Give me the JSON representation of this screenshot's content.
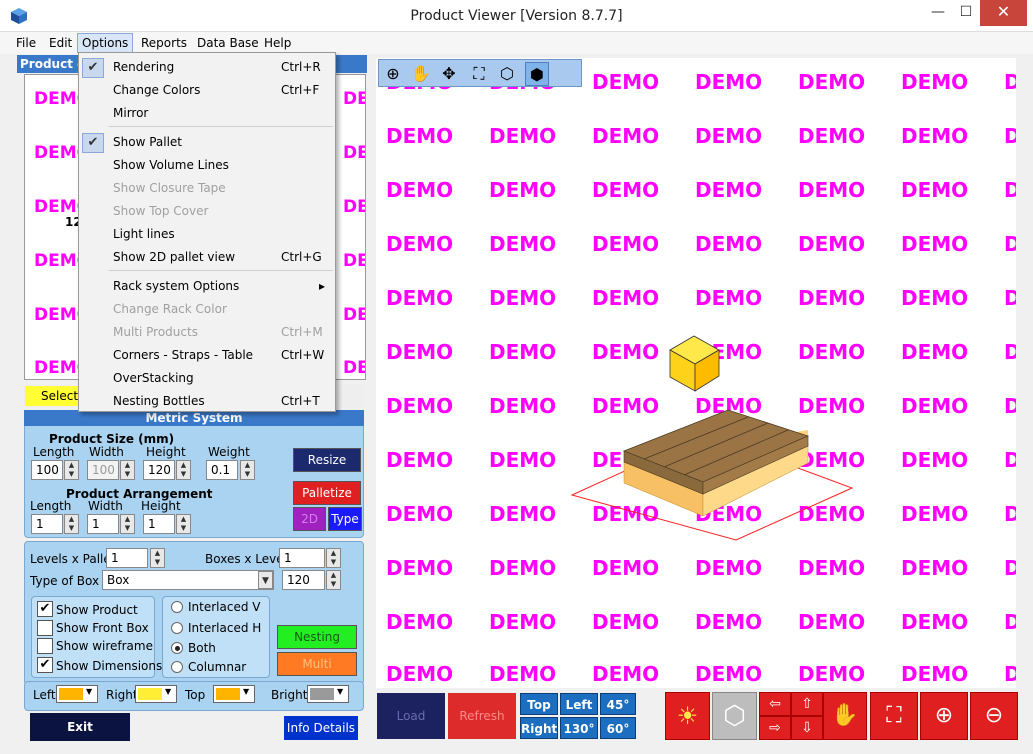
{
  "window": {
    "title": "Product Viewer [Version 8.7.7]",
    "minimize": "—",
    "maximize": "☐",
    "close": "✕"
  },
  "menubar": [
    "File",
    "Edit",
    "Options",
    "Reports",
    "Data Base",
    "Help"
  ],
  "options_menu": [
    {
      "label": "Rendering",
      "shortcut": "Ctrl+R",
      "checked": true,
      "disabled": false
    },
    {
      "label": "Change Colors",
      "shortcut": "Ctrl+F",
      "checked": false,
      "disabled": false
    },
    {
      "label": "Mirror",
      "shortcut": "",
      "checked": false,
      "disabled": false
    },
    {
      "label": "Show Pallet",
      "shortcut": "",
      "checked": true,
      "disabled": false
    },
    {
      "label": "Show Volume Lines",
      "shortcut": "",
      "checked": false,
      "disabled": false
    },
    {
      "label": "Show Closure Tape",
      "shortcut": "",
      "checked": false,
      "disabled": true
    },
    {
      "label": "Show Top Cover",
      "shortcut": "",
      "checked": false,
      "disabled": true
    },
    {
      "label": "Light lines",
      "shortcut": "",
      "checked": false,
      "disabled": false
    },
    {
      "label": "Show 2D pallet view",
      "shortcut": "Ctrl+G",
      "checked": false,
      "disabled": false
    },
    {
      "label": "Rack system Options",
      "shortcut": "▸",
      "checked": false,
      "disabled": false
    },
    {
      "label": "Change Rack Color",
      "shortcut": "",
      "checked": false,
      "disabled": true
    },
    {
      "label": "Multi Products",
      "shortcut": "Ctrl+M",
      "checked": false,
      "disabled": true
    },
    {
      "label": "Corners - Straps - Table",
      "shortcut": "Ctrl+W",
      "checked": false,
      "disabled": false
    },
    {
      "label": "OverStacking",
      "shortcut": "",
      "checked": false,
      "disabled": false
    },
    {
      "label": "Nesting Bottles",
      "shortcut": "Ctrl+T",
      "checked": false,
      "disabled": false
    }
  ],
  "product_panel": {
    "header": "Product d",
    "demo": "DEMO",
    "demo_right": "DE",
    "partial_number": "12",
    "select_label": "Select"
  },
  "metric": {
    "title": "Metric System",
    "product_size_title": "Product Size (mm)",
    "length_label": "Length",
    "width_label": "Width",
    "height_label": "Height",
    "weight_label": "Weight",
    "length": "100",
    "width": "100",
    "height": "120",
    "weight": "0.1",
    "arrangement_title": "Product Arrangement",
    "arr_length": "1",
    "arr_width": "1",
    "arr_height": "1",
    "resize": "Resize",
    "palletize": "Palletize",
    "btn_2d": "2D",
    "btn_type": "Type"
  },
  "config": {
    "levels_label": "Levels x Pallet",
    "levels": "1",
    "boxes_label": "Boxes x Level",
    "boxes": "1",
    "type_label": "Type of Box",
    "type": "Box",
    "type_value": "120",
    "show_product": "Show Product",
    "show_front_box": "Show Front Box",
    "show_wireframe": "Show wireframe",
    "show_dimensions": "Show Dimensions",
    "interlaced_v": "Interlaced V",
    "interlaced_h": "Interlaced H",
    "both": "Both",
    "columnar": "Columnar",
    "nesting": "Nesting",
    "multi": "Multi"
  },
  "colors": {
    "left_label": "Left",
    "right_label": "Right",
    "top_label": "Top",
    "bright_label": "Bright",
    "left": "#ffb400",
    "right": "#ffee33",
    "top": "#ffb400",
    "bright": "#9a9a9a"
  },
  "buttons": {
    "exit": "Exit",
    "info": "Info Details"
  },
  "viewer": {
    "demo": "DEMO",
    "demo_cut": "D"
  },
  "bottom": {
    "load": "Load",
    "refresh": "Refresh",
    "top": "Top",
    "left": "Left",
    "a45": "45°",
    "right": "Right",
    "a130": "130°",
    "a60": "60°"
  }
}
